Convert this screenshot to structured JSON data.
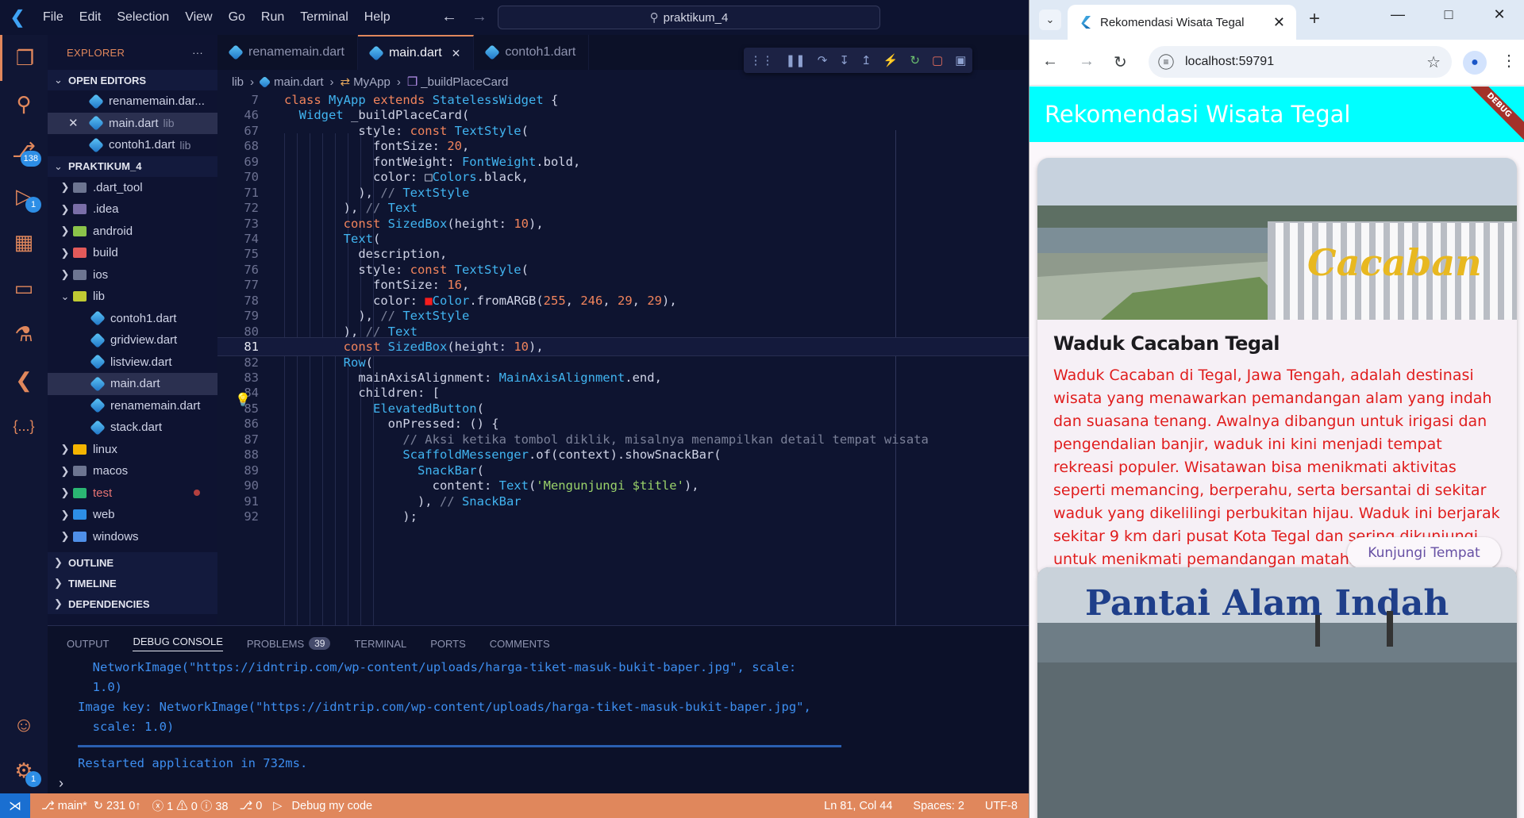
{
  "vscode": {
    "menu": [
      "File",
      "Edit",
      "Selection",
      "View",
      "Go",
      "Run",
      "Terminal",
      "Help"
    ],
    "search_text": "praktikum_4",
    "explorer_title": "EXPLORER",
    "open_editors_header": "OPEN EDITORS",
    "open_editors": [
      {
        "name": "renamemain.dar...",
        "desc": ""
      },
      {
        "name": "main.dart",
        "desc": "lib"
      },
      {
        "name": "contoh1.dart",
        "desc": "lib"
      }
    ],
    "project_header": "PRAKTIKUM_4",
    "tree": [
      {
        "name": ".dart_tool"
      },
      {
        "name": ".idea"
      },
      {
        "name": "android"
      },
      {
        "name": "build"
      },
      {
        "name": "ios"
      },
      {
        "name": "lib"
      },
      {
        "name": "contoh1.dart"
      },
      {
        "name": "gridview.dart"
      },
      {
        "name": "listview.dart"
      },
      {
        "name": "main.dart"
      },
      {
        "name": "renamemain.dart"
      },
      {
        "name": "stack.dart"
      },
      {
        "name": "linux"
      },
      {
        "name": "macos"
      },
      {
        "name": "test"
      },
      {
        "name": "web"
      },
      {
        "name": "windows"
      }
    ],
    "outline_header": "OUTLINE",
    "timeline_header": "TIMELINE",
    "dependencies_header": "DEPENDENCIES",
    "badges": {
      "source_control": "138",
      "run_debug": "1",
      "settings": "1"
    },
    "tabs": [
      "renamemain.dart",
      "main.dart",
      "contoh1.dart"
    ],
    "breadcrumb": [
      "lib",
      "main.dart",
      "MyApp",
      "_buildPlaceCard"
    ],
    "code_lines": [
      {
        "n": "7",
        "t": "class MyApp extends StatelessWidget {"
      },
      {
        "n": "46",
        "t": "  Widget _buildPlaceCard("
      },
      {
        "n": "67",
        "t": "          style: const TextStyle("
      },
      {
        "n": "68",
        "t": "            fontSize: 20,"
      },
      {
        "n": "69",
        "t": "            fontWeight: FontWeight.bold,"
      },
      {
        "n": "70",
        "t": "            color: □Colors.black,"
      },
      {
        "n": "71",
        "t": "          ), // TextStyle"
      },
      {
        "n": "72",
        "t": "        ), // Text"
      },
      {
        "n": "73",
        "t": "        const SizedBox(height: 10),"
      },
      {
        "n": "74",
        "t": "        Text("
      },
      {
        "n": "75",
        "t": "          description,"
      },
      {
        "n": "76",
        "t": "          style: const TextStyle("
      },
      {
        "n": "77",
        "t": "            fontSize: 16,"
      },
      {
        "n": "78",
        "t": "            color: ■Color.fromARGB(255, 246, 29, 29),"
      },
      {
        "n": "79",
        "t": "          ), // TextStyle"
      },
      {
        "n": "80",
        "t": "        ), // Text"
      },
      {
        "n": "81",
        "t": "        const SizedBox(height: 10),"
      },
      {
        "n": "82",
        "t": "        Row("
      },
      {
        "n": "83",
        "t": "          mainAxisAlignment: MainAxisAlignment.end,"
      },
      {
        "n": "84",
        "t": "          children: ["
      },
      {
        "n": "85",
        "t": "            ElevatedButton("
      },
      {
        "n": "86",
        "t": "              onPressed: () {"
      },
      {
        "n": "87",
        "t": "                // Aksi ketika tombol diklik, misalnya menampilkan detail tempat wisata"
      },
      {
        "n": "88",
        "t": "                ScaffoldMessenger.of(context).showSnackBar("
      },
      {
        "n": "89",
        "t": "                  SnackBar("
      },
      {
        "n": "90",
        "t": "                    content: Text('Mengunjungi $title'),"
      },
      {
        "n": "91",
        "t": "                  ), // SnackBar"
      },
      {
        "n": "92",
        "t": "                );"
      }
    ],
    "panel_tabs": [
      "OUTPUT",
      "DEBUG CONSOLE",
      "PROBLEMS",
      "TERMINAL",
      "PORTS",
      "COMMENTS"
    ],
    "problems_count": "39",
    "console_lines": [
      "  NetworkImage(\"https://idntrip.com/wp-content/uploads/harga-tiket-masuk-bukit-baper.jpg\", scale:",
      "  1.0)",
      "Image key: NetworkImage(\"https://idntrip.com/wp-content/uploads/harga-tiket-masuk-bukit-baper.jpg\",",
      "  scale: 1.0)"
    ],
    "console_restart": "Restarted application in 732ms.",
    "status": {
      "branch": "main*",
      "sync": "231 0↑",
      "problems": "ⓧ 1 ⚠ 0 ⓘ 38",
      "ports": "⎇ 0",
      "debug": "Debug my code",
      "position": "Ln 81, Col 44",
      "spaces": "Spaces: 2",
      "encoding": "UTF-8"
    }
  },
  "chrome": {
    "tab_title": "Rekomendasi Wisata Tegal",
    "url": "localhost:59791"
  },
  "app": {
    "appbar_title": "Rekomendasi Wisata Tegal",
    "debug_banner": "DEBUG",
    "cards": [
      {
        "title": "Waduk Cacaban Tegal",
        "description": "Waduk Cacaban di Tegal, Jawa Tengah, adalah destinasi wisata yang menawarkan pemandangan alam yang indah dan suasana tenang. Awalnya dibangun untuk irigasi dan pengendalian banjir, waduk ini kini menjadi tempat rekreasi populer. Wisatawan bisa menikmati aktivitas seperti memancing, berperahu, serta bersantai di sekitar waduk yang dikelilingi perbukitan hijau. Waduk ini berjarak sekitar 9 km dari pusat Kota Tegal dan sering dikunjungi untuk menikmati pemandangan matahari terbenam serta udara yang sejuk.",
        "button": "Kunjungi Tempat",
        "image_sign": "Cacaban"
      },
      {
        "image_sign": "Pantai Alam Indah"
      }
    ]
  },
  "colors": {
    "accent": "#e0875c",
    "appbar": "#00ffff",
    "description_text": "#e01d1d",
    "button_text": "#6750a4"
  }
}
